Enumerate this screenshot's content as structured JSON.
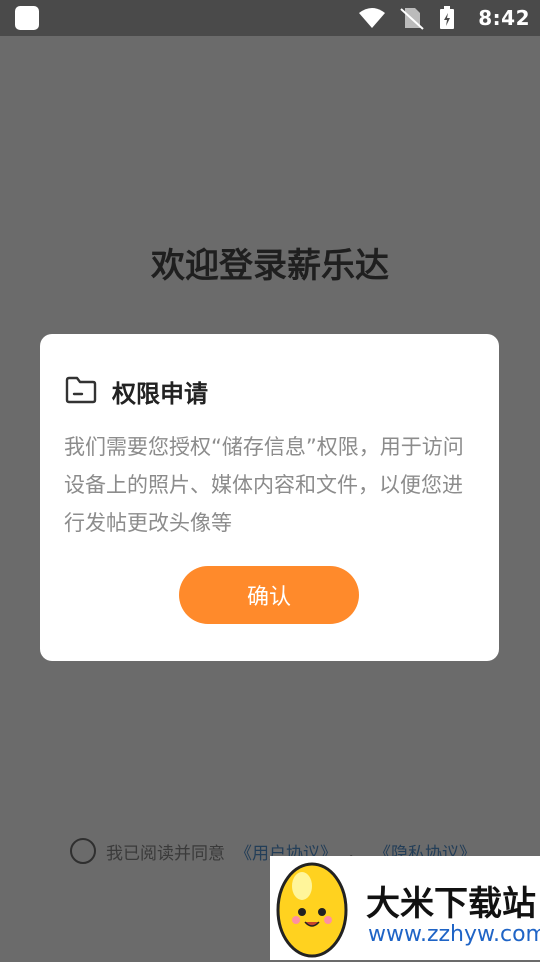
{
  "status_bar": {
    "time": "8:42"
  },
  "page": {
    "welcome_title": "欢迎登录薪乐达",
    "agreement": {
      "text": "我已阅读并同意",
      "user_agreement": "《用户协议》",
      "separator": "，",
      "privacy_agreement": "《隐私协议》"
    }
  },
  "dialog": {
    "icon": "folder-icon",
    "title": "权限申请",
    "message": "我们需要您授权“储存信息”权限，用于访问设备上的照片、媒体内容和文件，以便您进行发帖更改头像等",
    "confirm_label": "确认",
    "colors": {
      "confirm": "#ff8a2b"
    }
  },
  "watermark": {
    "title": "大米下载站",
    "url": "www.zzhyw.com"
  }
}
